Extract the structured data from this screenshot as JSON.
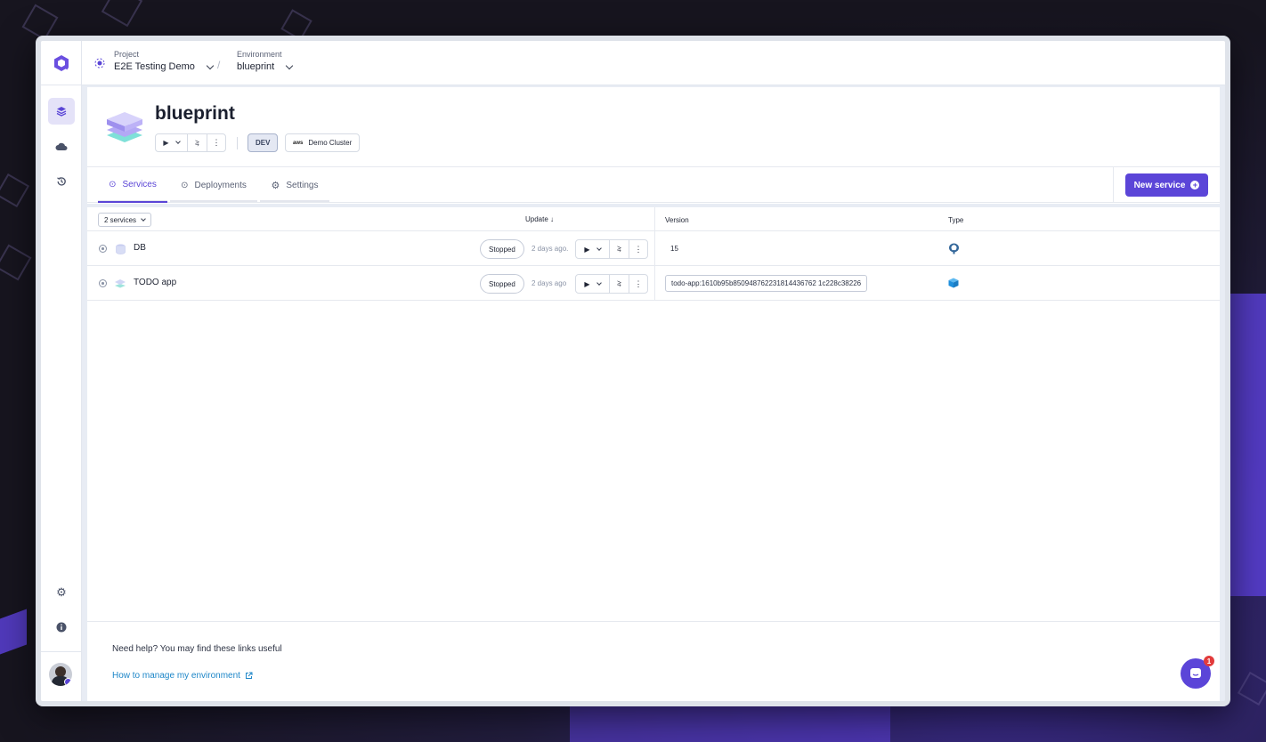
{
  "topbar": {
    "project_label": "Project",
    "project_value": "E2E Testing Demo",
    "separator": "/",
    "environment_label": "Environment",
    "environment_value": "blueprint"
  },
  "sidebar": {
    "items": [
      {
        "name": "layers-icon",
        "active": true
      },
      {
        "name": "cloud-icon",
        "active": false
      },
      {
        "name": "history-icon",
        "active": false
      }
    ],
    "bottom_items": [
      {
        "name": "gear-icon"
      },
      {
        "name": "info-icon"
      }
    ]
  },
  "environment": {
    "title": "blueprint",
    "mode_tag": "DEV",
    "cluster": "Demo Cluster",
    "cluster_provider": "aws"
  },
  "tabs": [
    {
      "label": "Services",
      "active": true,
      "icon": "target-icon"
    },
    {
      "label": "Deployments",
      "active": false,
      "icon": "target-icon"
    },
    {
      "label": "Settings",
      "active": false,
      "icon": "gear-icon"
    }
  ],
  "new_service_label": "New service",
  "table": {
    "count_label": "2 services",
    "col_update": "Update ↓",
    "col_version": "Version",
    "col_type": "Type",
    "rows": [
      {
        "name": "DB",
        "status": "Stopped",
        "updated": "2 days ago.",
        "version": "15",
        "type": "postgresql"
      },
      {
        "name": "TODO app",
        "status": "Stopped",
        "updated": "2 days ago",
        "version": "todo-app:1610b95b850948762231814436762 1c228c38226",
        "type": "container"
      }
    ]
  },
  "footer": {
    "help_text": "Need help? You may find these links useful",
    "help_link": "How to manage my environment"
  },
  "chat_badge_count": "1",
  "colors": {
    "accent": "#5b45d8",
    "link": "#1d86c8"
  }
}
